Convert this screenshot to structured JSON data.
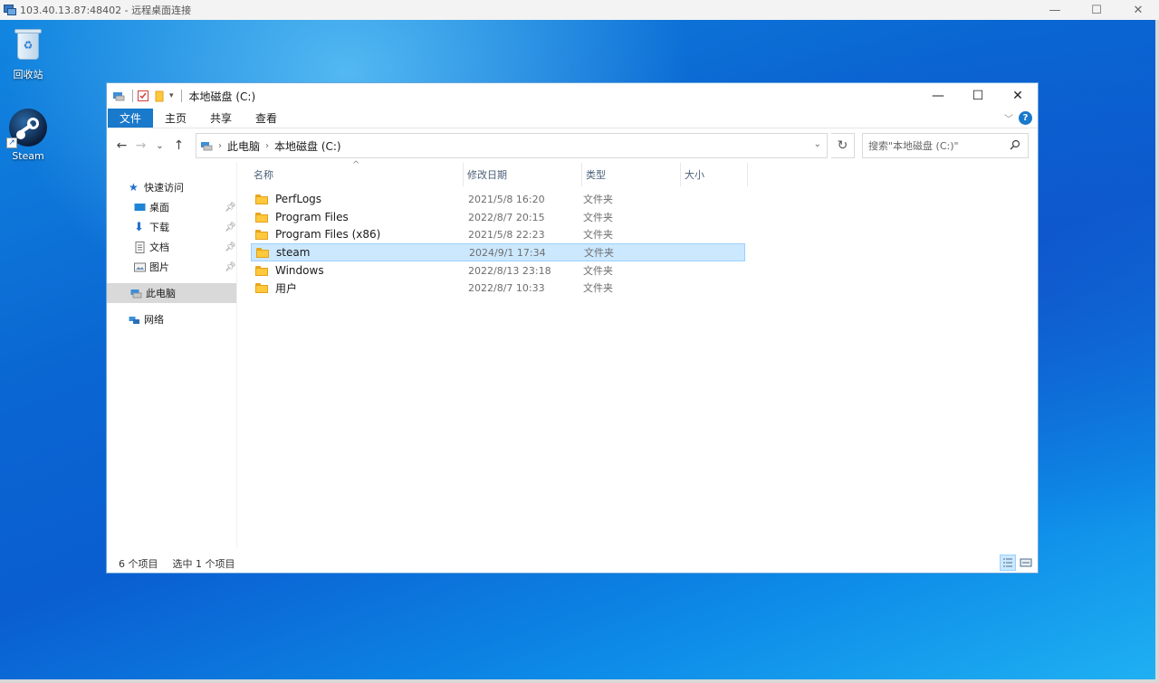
{
  "rdp": {
    "title": "103.40.13.87:48402 - 远程桌面连接",
    "controls": {
      "minimize": "—",
      "maximize": "☐",
      "close": "✕"
    }
  },
  "desktop": {
    "icons": [
      {
        "label": "回收站",
        "icon": "recycle-bin-icon"
      },
      {
        "label": "Steam",
        "icon": "steam-icon"
      }
    ]
  },
  "explorer": {
    "title": "本地磁盘 (C:)",
    "controls": {
      "minimize": "—",
      "maximize": "☐",
      "close": "✕"
    },
    "ribbon": {
      "tabs": [
        "文件",
        "主页",
        "共享",
        "查看"
      ]
    },
    "address": {
      "back": "←",
      "forward": "→",
      "recent": "⌄",
      "up": "↑",
      "crumbs": [
        "此电脑",
        "本地磁盘 (C:)"
      ],
      "refresh": "↻",
      "dropdown": "⌄"
    },
    "search": {
      "placeholder": "搜索\"本地磁盘 (C:)\""
    },
    "nav": {
      "quick_access": "快速访问",
      "items": [
        {
          "label": "桌面",
          "icon": "desktop-icon",
          "pinned": true
        },
        {
          "label": "下载",
          "icon": "download-icon",
          "pinned": true
        },
        {
          "label": "文档",
          "icon": "document-icon",
          "pinned": true
        },
        {
          "label": "图片",
          "icon": "pictures-icon",
          "pinned": true
        }
      ],
      "this_pc": "此电脑",
      "network": "网络"
    },
    "columns": {
      "name": "名称",
      "modified": "修改日期",
      "type": "类型",
      "size": "大小"
    },
    "files": [
      {
        "name": "PerfLogs",
        "modified": "2021/5/8 16:20",
        "type": "文件夹"
      },
      {
        "name": "Program Files",
        "modified": "2022/8/7 20:15",
        "type": "文件夹"
      },
      {
        "name": "Program Files (x86)",
        "modified": "2021/5/8 22:23",
        "type": "文件夹"
      },
      {
        "name": "steam",
        "modified": "2024/9/1 17:34",
        "type": "文件夹",
        "selected": true
      },
      {
        "name": "Windows",
        "modified": "2022/8/13 23:18",
        "type": "文件夹"
      },
      {
        "name": "用户",
        "modified": "2022/8/7 10:33",
        "type": "文件夹"
      }
    ],
    "status": {
      "count": "6 个项目",
      "selection": "选中 1 个项目"
    }
  },
  "colors": {
    "accent": "#1979ca",
    "selection": "#cce8ff",
    "folder": "#ffc83d"
  }
}
